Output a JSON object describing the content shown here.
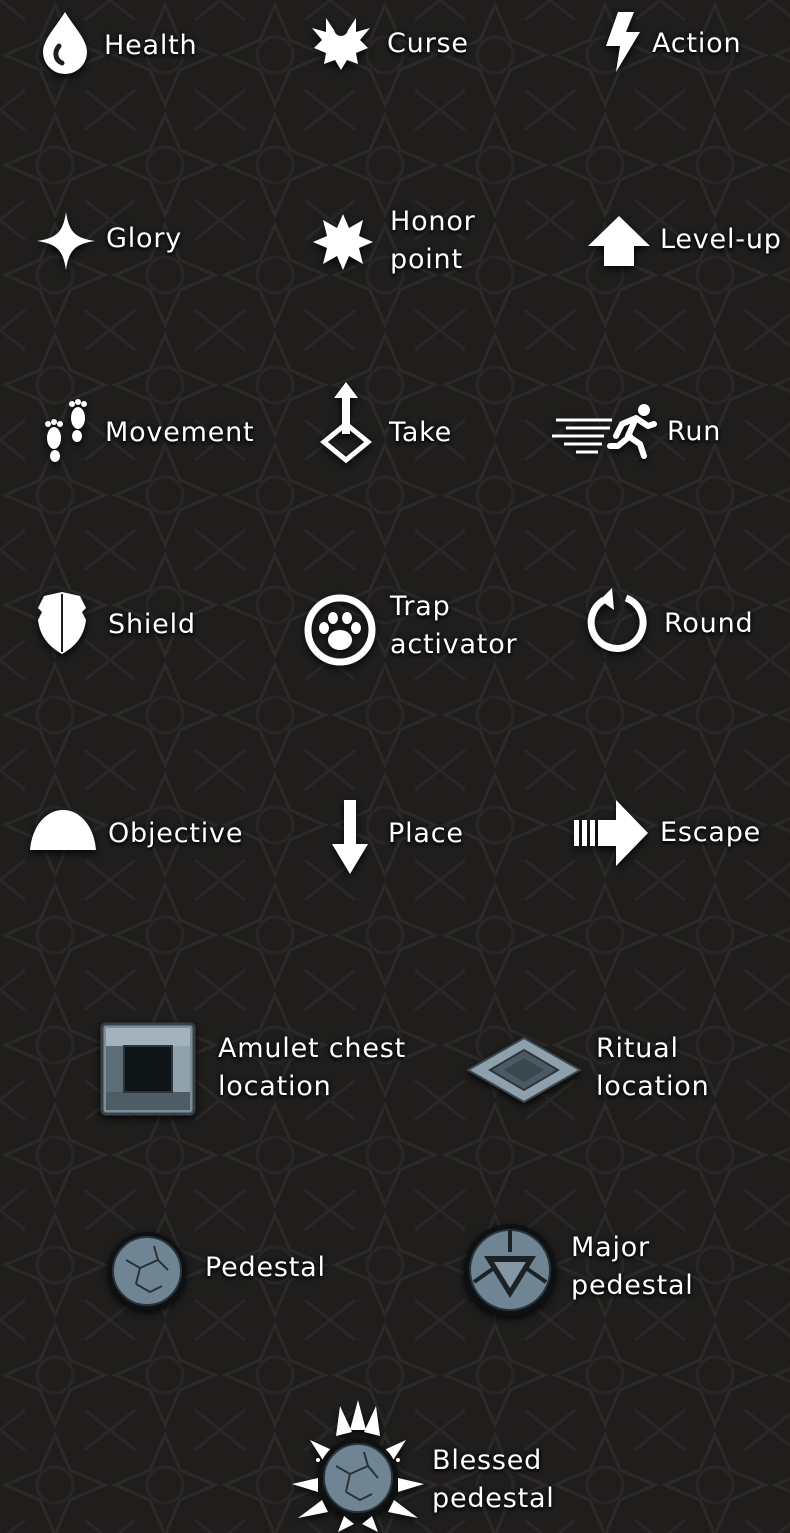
{
  "legend": {
    "health": "Health",
    "curse": "Curse",
    "action": "Action",
    "glory": "Glory",
    "honor_point": [
      "Honor",
      "point"
    ],
    "level_up": "Level-up",
    "movement": "Movement",
    "take": "Take",
    "run": "Run",
    "shield": "Shield",
    "trap_activator": [
      "Trap",
      "activator"
    ],
    "round": "Round",
    "objective": "Objective",
    "place": "Place",
    "escape": "Escape",
    "amulet_chest_location": [
      "Amulet chest",
      "location"
    ],
    "ritual_location": [
      "Ritual",
      "location"
    ],
    "pedestal": "Pedestal",
    "major_pedestal": [
      "Major",
      "pedestal"
    ],
    "blessed_pedestal": [
      "Blessed",
      "pedestal"
    ]
  },
  "colors": {
    "background": "#1f1e1d",
    "icon": "#ffffff",
    "stone": "#6f8593"
  }
}
